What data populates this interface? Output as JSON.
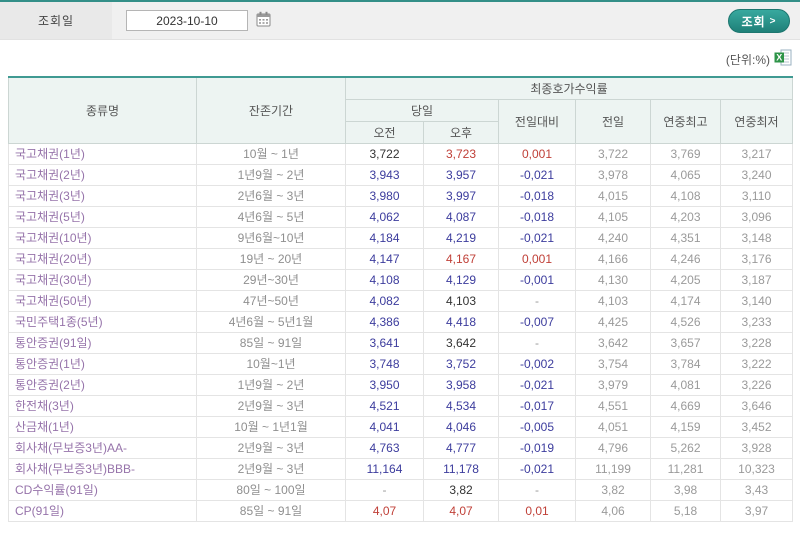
{
  "toolbar": {
    "date_label": "조회일",
    "date_value": "2023-10-10",
    "search_label": "조회",
    "search_arrow": ">"
  },
  "unit_label": "(단위:%)",
  "colors": {
    "accent_teal": "#338f88",
    "up_red": "#c04038",
    "down_blue": "#3c3c9d",
    "neutral_black": "#333333",
    "muted_gray": "#9a9a9a",
    "name_purple": "#9673aa",
    "header_bg": "#edf4f2"
  },
  "table": {
    "headers": {
      "col_type": "종류명",
      "col_period": "잔존기간",
      "group_yield": "최종호가수익률",
      "group_today": "당일",
      "col_am": "오전",
      "col_pm": "오후",
      "col_change": "전일대비",
      "col_prev": "전일",
      "col_high": "연중최고",
      "col_low": "연중최저"
    },
    "rows": [
      {
        "name": "국고채권(1년)",
        "period": "10월 ~ 1년",
        "am": "3,722",
        "pm": "3,723",
        "chg": "0,001",
        "prev": "3,722",
        "high": "3,769",
        "low": "3,217",
        "am_c": "black",
        "pm_c": "red",
        "chg_c": "red"
      },
      {
        "name": "국고채권(2년)",
        "period": "1년9월 ~ 2년",
        "am": "3,943",
        "pm": "3,957",
        "chg": "-0,021",
        "prev": "3,978",
        "high": "4,065",
        "low": "3,240",
        "am_c": "blue",
        "pm_c": "blue",
        "chg_c": "blue"
      },
      {
        "name": "국고채권(3년)",
        "period": "2년6월 ~ 3년",
        "am": "3,980",
        "pm": "3,997",
        "chg": "-0,018",
        "prev": "4,015",
        "high": "4,108",
        "low": "3,110",
        "am_c": "blue",
        "pm_c": "blue",
        "chg_c": "blue"
      },
      {
        "name": "국고채권(5년)",
        "period": "4년6월 ~ 5년",
        "am": "4,062",
        "pm": "4,087",
        "chg": "-0,018",
        "prev": "4,105",
        "high": "4,203",
        "low": "3,096",
        "am_c": "blue",
        "pm_c": "blue",
        "chg_c": "blue"
      },
      {
        "name": "국고채권(10년)",
        "period": "9년6월~10년",
        "am": "4,184",
        "pm": "4,219",
        "chg": "-0,021",
        "prev": "4,240",
        "high": "4,351",
        "low": "3,148",
        "am_c": "blue",
        "pm_c": "blue",
        "chg_c": "blue"
      },
      {
        "name": "국고채권(20년)",
        "period": "19년 ~ 20년",
        "am": "4,147",
        "pm": "4,167",
        "chg": "0,001",
        "prev": "4,166",
        "high": "4,246",
        "low": "3,176",
        "am_c": "blue",
        "pm_c": "red",
        "chg_c": "red"
      },
      {
        "name": "국고채권(30년)",
        "period": "29년~30년",
        "am": "4,108",
        "pm": "4,129",
        "chg": "-0,001",
        "prev": "4,130",
        "high": "4,205",
        "low": "3,187",
        "am_c": "blue",
        "pm_c": "blue",
        "chg_c": "blue"
      },
      {
        "name": "국고채권(50년)",
        "period": "47년~50년",
        "am": "4,082",
        "pm": "4,103",
        "chg": "-",
        "prev": "4,103",
        "high": "4,174",
        "low": "3,140",
        "am_c": "blue",
        "pm_c": "black",
        "chg_c": "gray"
      },
      {
        "name": "국민주택1종(5년)",
        "period": "4년6월 ~ 5년1월",
        "am": "4,386",
        "pm": "4,418",
        "chg": "-0,007",
        "prev": "4,425",
        "high": "4,526",
        "low": "3,233",
        "am_c": "blue",
        "pm_c": "blue",
        "chg_c": "blue"
      },
      {
        "name": "통안증권(91일)",
        "period": "85일 ~ 91일",
        "am": "3,641",
        "pm": "3,642",
        "chg": "-",
        "prev": "3,642",
        "high": "3,657",
        "low": "3,228",
        "am_c": "blue",
        "pm_c": "black",
        "chg_c": "gray"
      },
      {
        "name": "통안증권(1년)",
        "period": "10월~1년",
        "am": "3,748",
        "pm": "3,752",
        "chg": "-0,002",
        "prev": "3,754",
        "high": "3,784",
        "low": "3,222",
        "am_c": "blue",
        "pm_c": "blue",
        "chg_c": "blue"
      },
      {
        "name": "통안증권(2년)",
        "period": "1년9월 ~ 2년",
        "am": "3,950",
        "pm": "3,958",
        "chg": "-0,021",
        "prev": "3,979",
        "high": "4,081",
        "low": "3,226",
        "am_c": "blue",
        "pm_c": "blue",
        "chg_c": "blue"
      },
      {
        "name": "한전채(3년)",
        "period": "2년9월 ~ 3년",
        "am": "4,521",
        "pm": "4,534",
        "chg": "-0,017",
        "prev": "4,551",
        "high": "4,669",
        "low": "3,646",
        "am_c": "blue",
        "pm_c": "blue",
        "chg_c": "blue"
      },
      {
        "name": "산금채(1년)",
        "period": "10월 ~ 1년1월",
        "am": "4,041",
        "pm": "4,046",
        "chg": "-0,005",
        "prev": "4,051",
        "high": "4,159",
        "low": "3,452",
        "am_c": "blue",
        "pm_c": "blue",
        "chg_c": "blue"
      },
      {
        "name": "회사채(무보증3년)AA-",
        "period": "2년9월 ~ 3년",
        "am": "4,763",
        "pm": "4,777",
        "chg": "-0,019",
        "prev": "4,796",
        "high": "5,262",
        "low": "3,928",
        "am_c": "blue",
        "pm_c": "blue",
        "chg_c": "blue"
      },
      {
        "name": "회사채(무보증3년)BBB-",
        "period": "2년9월 ~ 3년",
        "am": "11,164",
        "pm": "11,178",
        "chg": "-0,021",
        "prev": "11,199",
        "high": "11,281",
        "low": "10,323",
        "am_c": "blue",
        "pm_c": "blue",
        "chg_c": "blue"
      },
      {
        "name": "CD수익률(91일)",
        "period": "80일 ~ 100일",
        "am": "-",
        "pm": "3,82",
        "chg": "-",
        "prev": "3,82",
        "high": "3,98",
        "low": "3,43",
        "am_c": "gray",
        "pm_c": "black",
        "chg_c": "gray"
      },
      {
        "name": "CP(91일)",
        "period": "85일 ~ 91일",
        "am": "4,07",
        "pm": "4,07",
        "chg": "0,01",
        "prev": "4,06",
        "high": "5,18",
        "low": "3,97",
        "am_c": "red",
        "pm_c": "red",
        "chg_c": "red"
      }
    ]
  }
}
